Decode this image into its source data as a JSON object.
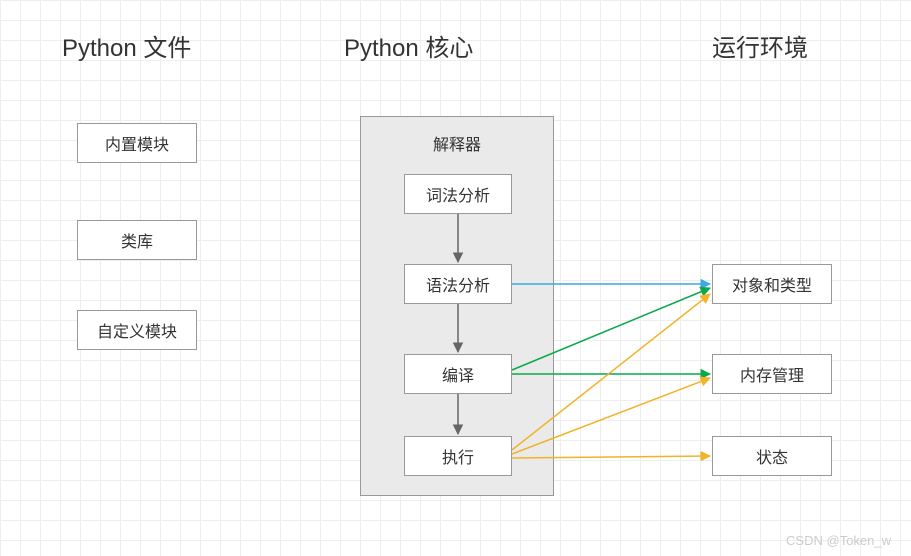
{
  "headers": {
    "files": "Python 文件",
    "core": "Python 核心",
    "runtime": "运行环境"
  },
  "files_column": {
    "builtin": "内置模块",
    "library": "类库",
    "custom": "自定义模块"
  },
  "interpreter": {
    "title": "解释器",
    "steps": {
      "lex": "词法分析",
      "parse": "语法分析",
      "compile": "编译",
      "execute": "执行"
    }
  },
  "runtime": {
    "objects": "对象和类型",
    "memory": "内存管理",
    "state": "状态"
  },
  "watermark": "CSDN @Token_w",
  "colors": {
    "blue": "#3ba9e4",
    "green": "#0aa84a",
    "orange": "#f0b429",
    "gray": "#666"
  }
}
